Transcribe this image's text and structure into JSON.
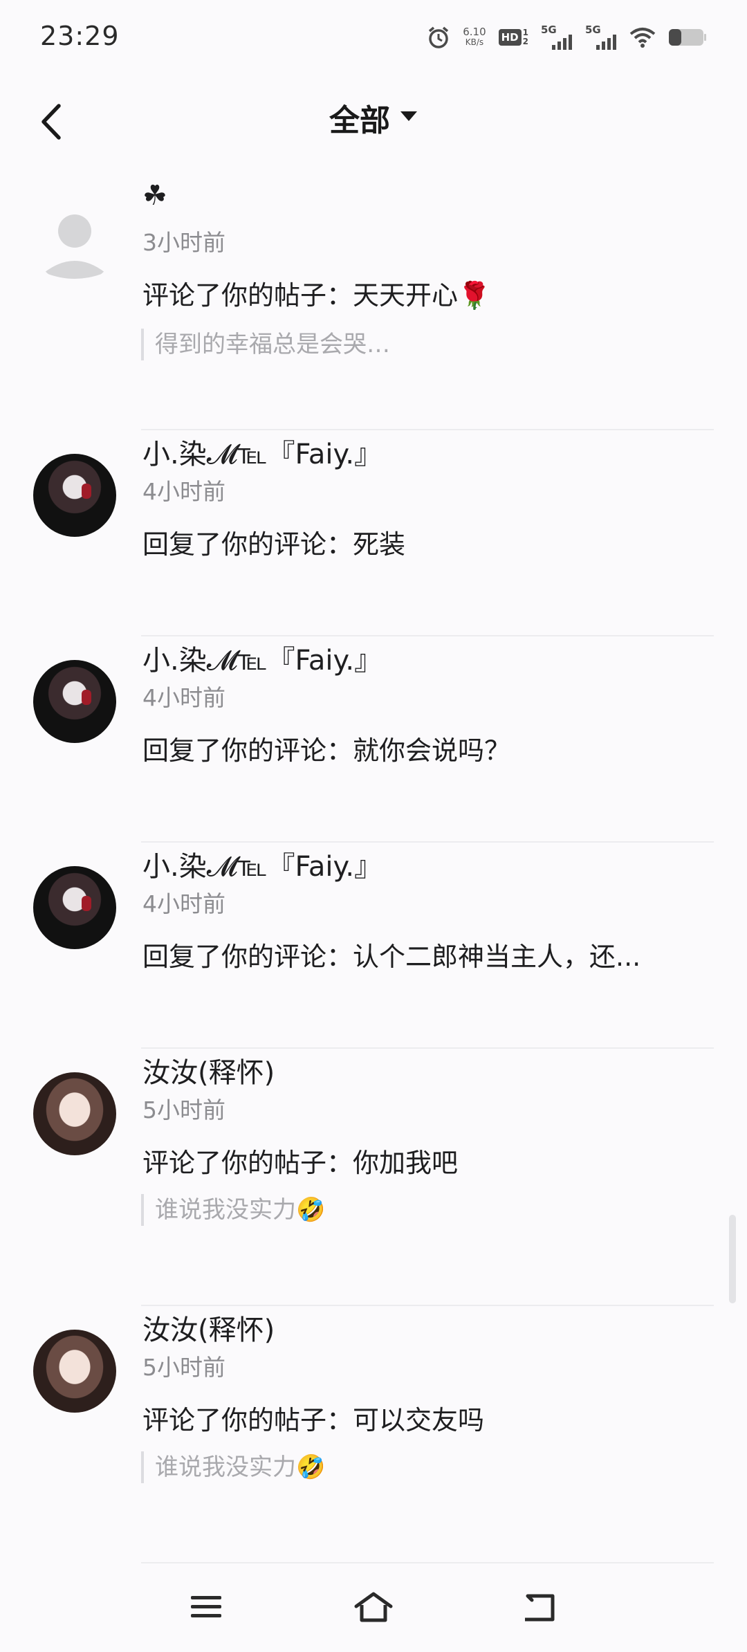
{
  "status_bar": {
    "time": "23:29",
    "net_speed_value": "6.10",
    "net_speed_unit": "KB/s",
    "hd_label": "HD",
    "hd_sub_top": "1",
    "hd_sub_bottom": "2",
    "sim1_label": "5G",
    "sim2_label": "5G",
    "icons": [
      "alarm-icon",
      "hd-icon",
      "signal-icon",
      "signal-icon",
      "wifi-icon",
      "battery-icon"
    ],
    "battery_level_fraction": 0.35
  },
  "header": {
    "title": "全部",
    "back_icon": "chevron-left-icon",
    "dropdown_icon": "caret-down-icon"
  },
  "notifications": [
    {
      "name": "☘",
      "time": "3小时前",
      "action": "评论了你的帖子：天天开心🌹",
      "quote": "得到的幸福总是会哭…",
      "avatar": "default"
    },
    {
      "name": "小.染𝓜℡『Faiy.』",
      "time": "4小时前",
      "action": "回复了你的评论：死装",
      "quote": "",
      "avatar": "dark"
    },
    {
      "name": "小.染𝓜℡『Faiy.』",
      "time": "4小时前",
      "action": "回复了你的评论：就你会说吗？",
      "quote": "",
      "avatar": "dark"
    },
    {
      "name": "小.染𝓜℡『Faiy.』",
      "time": "4小时前",
      "action": "回复了你的评论：认个二郎神当主人，还...",
      "quote": "",
      "avatar": "dark"
    },
    {
      "name": "汝汝(释怀)",
      "time": "5小时前",
      "action": "评论了你的帖子：你加我吧",
      "quote": "谁说我没实力🤣",
      "avatar": "girl"
    },
    {
      "name": "汝汝(释怀)",
      "time": "5小时前",
      "action": "评论了你的帖子：可以交友吗",
      "quote": "谁说我没实力🤣",
      "avatar": "girl"
    }
  ],
  "nav_bar": {
    "icons": [
      "menu-icon",
      "home-icon",
      "back-icon"
    ]
  },
  "colors": {
    "background": "#fbfafc",
    "primary_text": "#1e1e20",
    "secondary_text": "#8c8c90",
    "quote_text": "#a9a9ad",
    "divider": "#ececef"
  }
}
